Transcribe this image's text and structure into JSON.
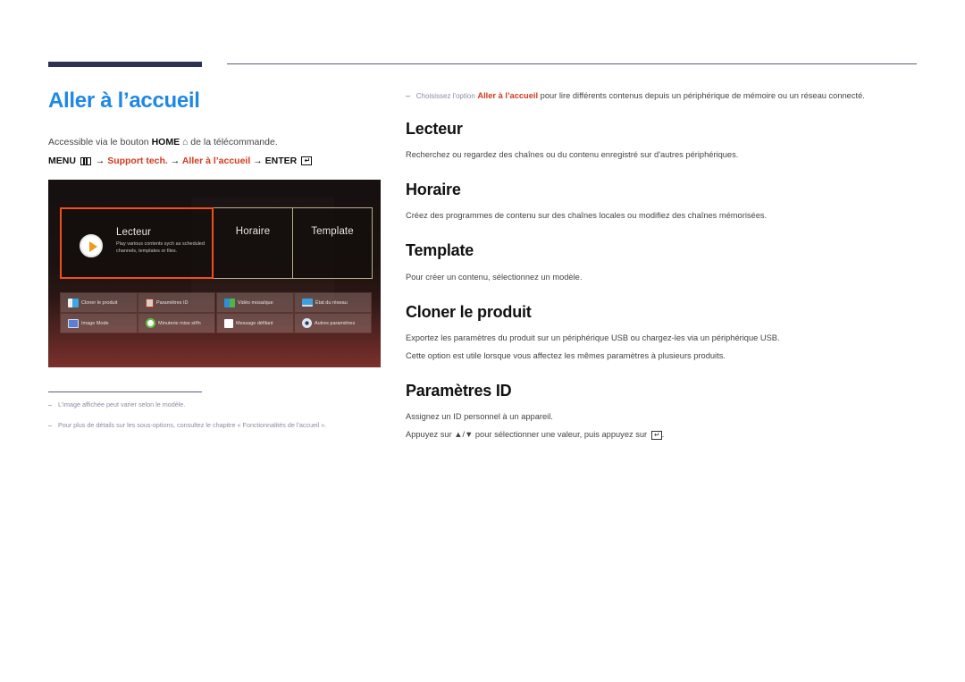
{
  "page": {
    "title": "Aller à l’accueil",
    "access_prefix": "Accessible via le bouton",
    "access_button": "HOME",
    "access_suffix": "de la télécommande.",
    "home_icon": "⌂",
    "menu_path": {
      "menu_label": "MENU",
      "arrow": "→",
      "step1": "Support tech.",
      "step2": "Aller à l’accueil",
      "enter_label": "ENTER",
      "enter_icon": "↵"
    }
  },
  "tv_screen": {
    "tiles": [
      {
        "label": "Lecteur",
        "description": "Play various contents sych as scheduled channels, templates or files.",
        "selected": true
      },
      {
        "label": "Horaire",
        "selected": false
      },
      {
        "label": "Template",
        "selected": false
      }
    ],
    "grid_items": [
      {
        "label": "Cloner le produit",
        "icon": "clone-icon"
      },
      {
        "label": "Paramètres ID",
        "icon": "id-badge-icon"
      },
      {
        "label": "Vidéo mosaïque",
        "icon": "video-wall-icon"
      },
      {
        "label": "État du réseau",
        "icon": "network-status-icon"
      },
      {
        "label": "Image Mode",
        "icon": "monitor-icon"
      },
      {
        "label": "Minuterie mise st/fn",
        "icon": "timer-icon"
      },
      {
        "label": "Message défilant",
        "icon": "message-icon"
      },
      {
        "label": "Autres paramètres",
        "icon": "gear-icon"
      }
    ]
  },
  "notes": [
    "L'image affichée peut varier selon le modèle.",
    "Pour plus de détails sur les sous-options, consultez le chapitre « Fonctionnalités de l'accueil »."
  ],
  "intro": {
    "dash": "–",
    "prefix": "Choisissez l'option",
    "highlight": "Aller à l’accueil",
    "suffix": "pour lire différents contenus depuis un périphérique de mémoire ou un réseau connecté."
  },
  "sections": {
    "lecteur": {
      "title": "Lecteur",
      "text": "Recherchez ou regardez des chaînes ou du contenu enregistré sur d'autres périphériques."
    },
    "horaire": {
      "title": "Horaire",
      "text": "Créez des programmes de contenu sur des chaînes locales ou modifiez des chaînes mémorisées."
    },
    "template": {
      "title": "Template",
      "text": "Pour créer un contenu, sélectionnez un modèle."
    },
    "cloner": {
      "title": "Cloner le produit",
      "text1": "Exportez les paramètres du produit sur un périphérique USB ou chargez-les via un périphérique USB.",
      "text2": "Cette option est utile lorsque vous affectez les mêmes paramètres à plusieurs produits."
    },
    "parametres_id": {
      "title": "Paramètres ID",
      "text1": "Assignez un ID personnel à un appareil.",
      "text2_prefix": "Appuyez sur",
      "arrows": "▲/▼",
      "text2_mid": "pour sélectionner une valeur, puis appuyez sur",
      "enter_icon": "↵",
      "text2_end": "."
    }
  },
  "colors": {
    "title_blue": "#1e88e5",
    "accent_red": "#d03a1c",
    "selection_orange": "#f04f1a",
    "rule_navy": "#2d3155"
  }
}
